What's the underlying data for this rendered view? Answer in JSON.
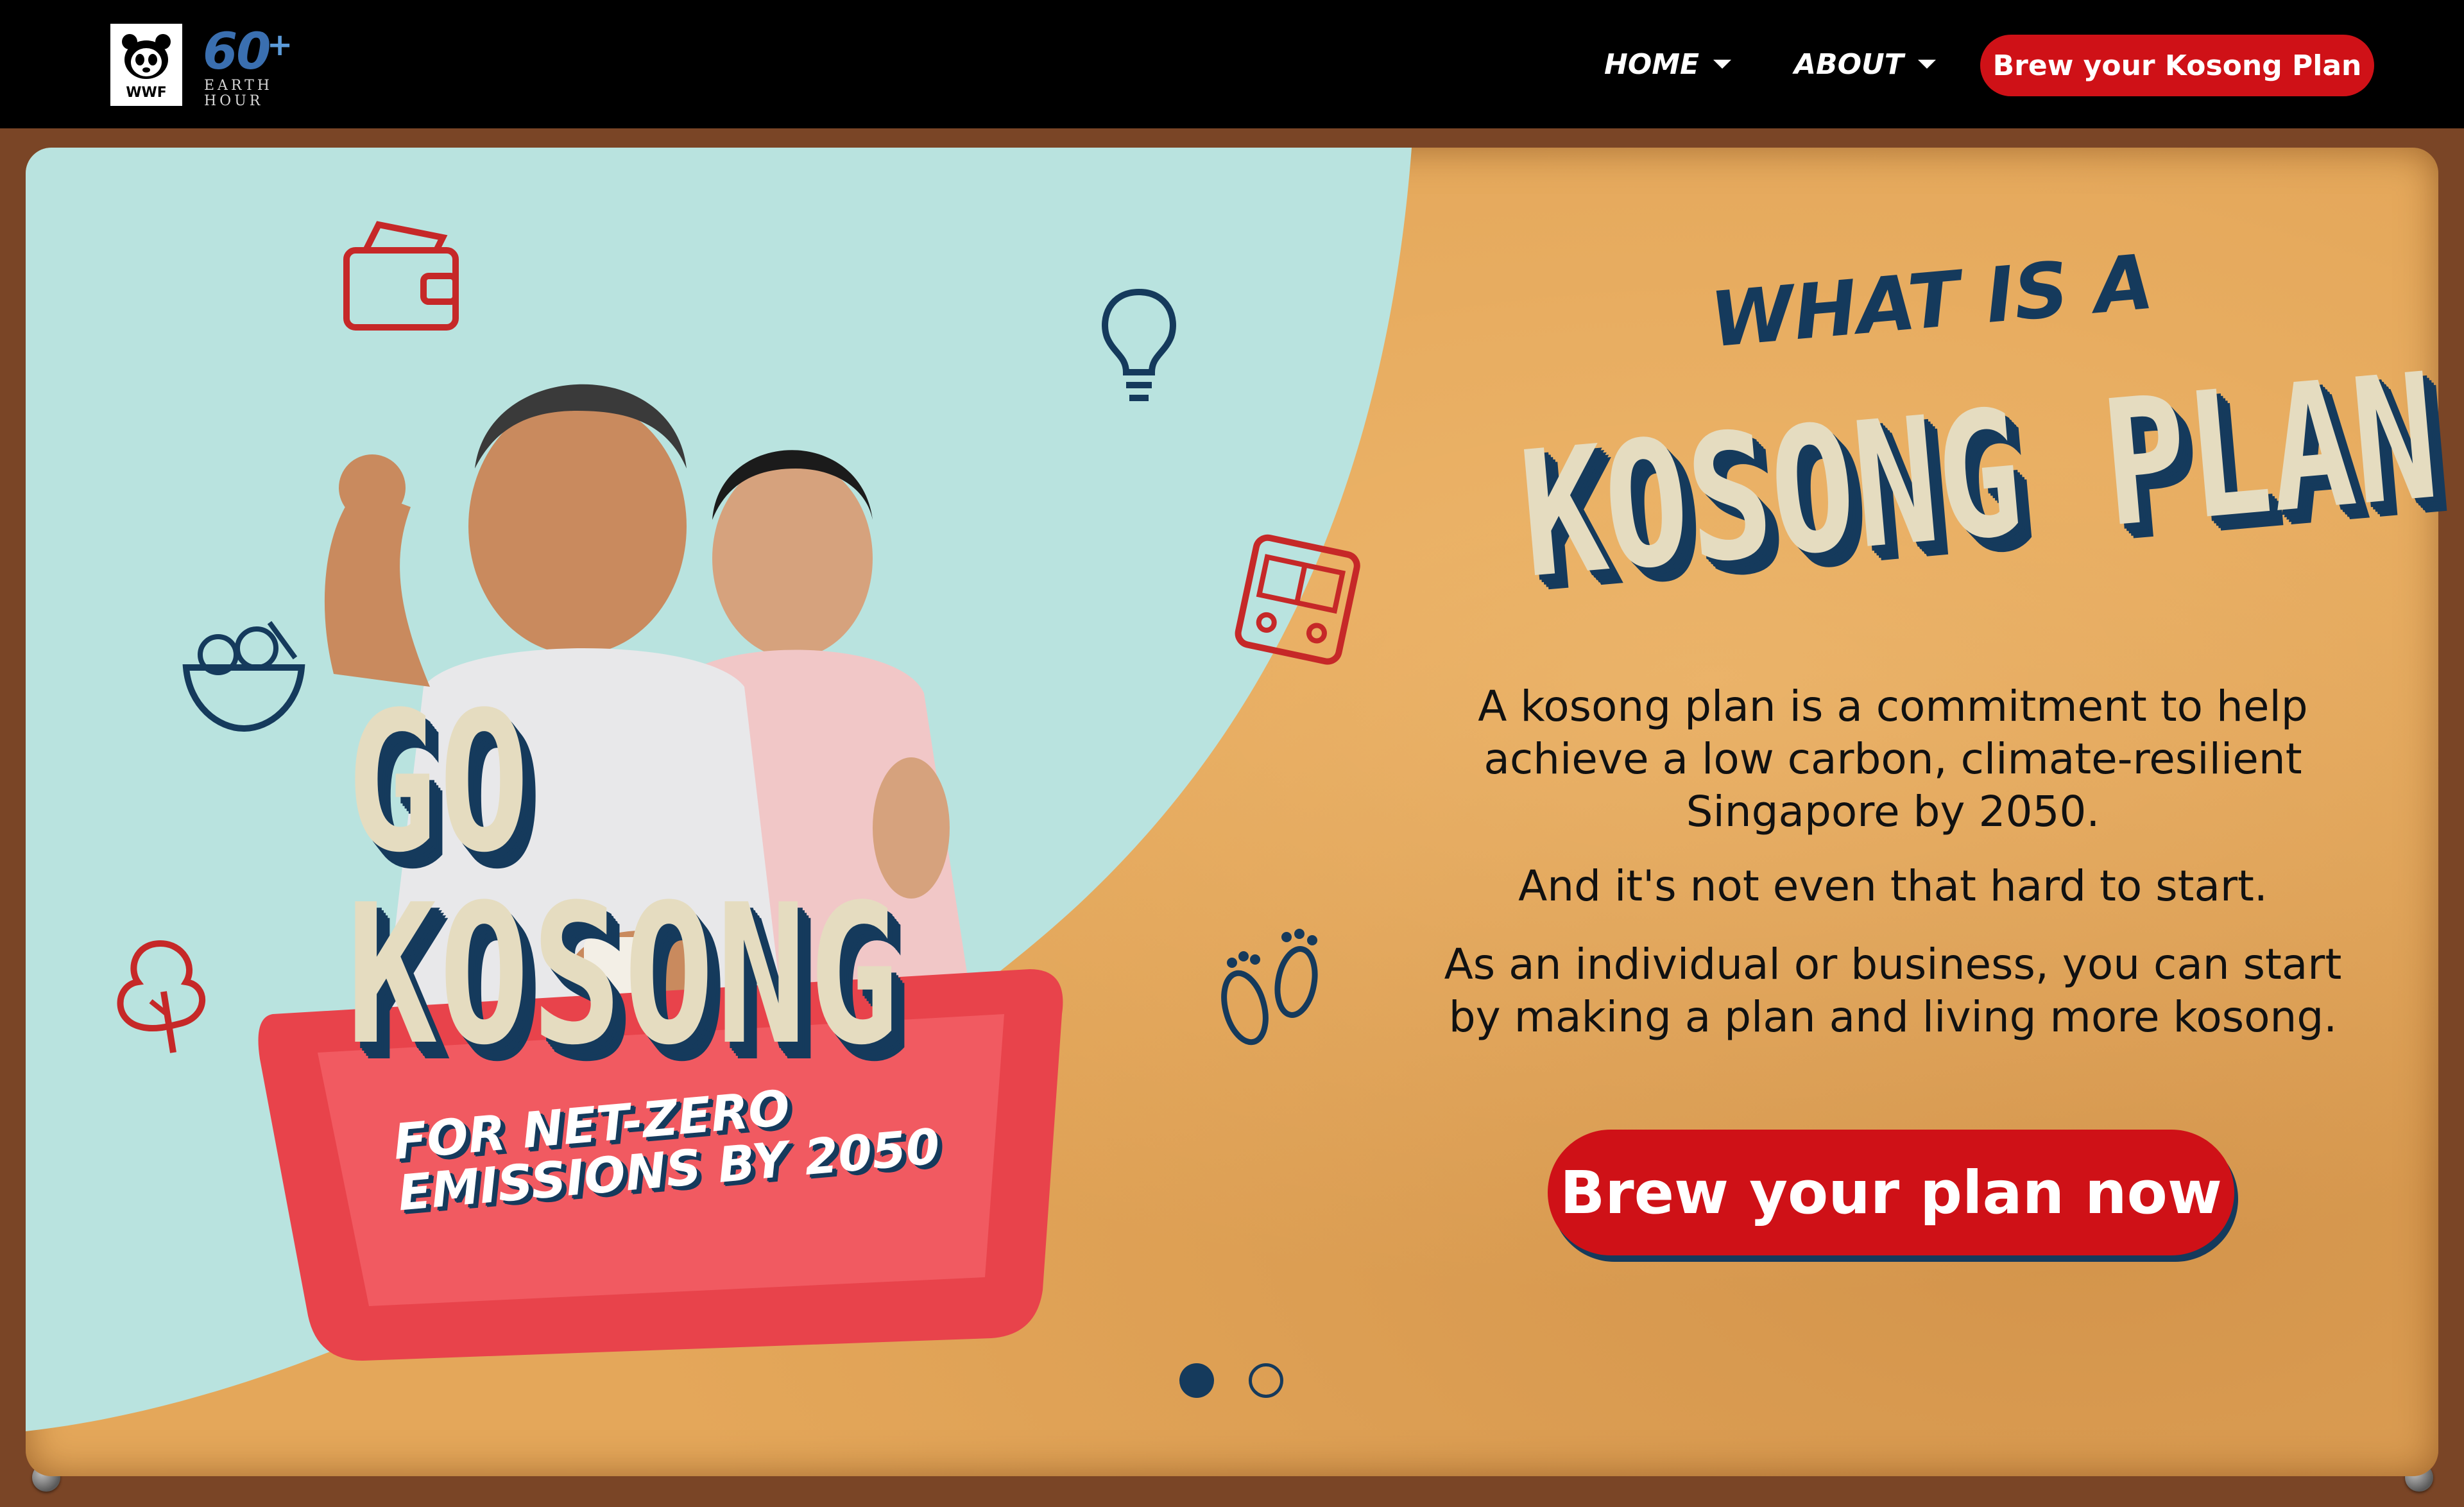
{
  "nav": {
    "logo_wwf": "WWF",
    "logo_earth_hour_number": "60",
    "logo_earth_hour_plus": "+",
    "logo_earth_hour_line1": "EARTH",
    "logo_earth_hour_line2": "HOUR",
    "home_label": "HOME",
    "about_label": "ABOUT",
    "cta_label": "Brew your Kosong Plan"
  },
  "hero": {
    "headline_go": "GO",
    "headline_kosong": "KOSONG",
    "tagline_line1": "FOR NET-ZERO",
    "tagline_line2": "EMISSIONS BY 2050",
    "what_is": "WHAT IS A",
    "kosong_plan": "KOSONG PLAN",
    "paragraph1": "A kosong plan is a commitment to help achieve a low carbon, climate-resilient Singapore by 2050.",
    "paragraph2": "And it's not even that hard to start.",
    "paragraph3": "As an individual or business, you can start by making a plan and living more kosong.",
    "cta_label": "Brew your plan now",
    "carousel": {
      "active_slide": 1,
      "total_slides": 2
    }
  },
  "colors": {
    "nav_bg": "#000000",
    "accent_red": "#cf1117",
    "navy": "#153a5c",
    "cream": "#e5dcc0",
    "board_orange": "#e4a75a",
    "mint": "#b9e3df",
    "rust": "#7a4526"
  },
  "icons": [
    "wallet-icon",
    "lightbulb-icon",
    "bus-icon",
    "salad-bowl-icon",
    "tree-icon",
    "footprints-icon"
  ]
}
